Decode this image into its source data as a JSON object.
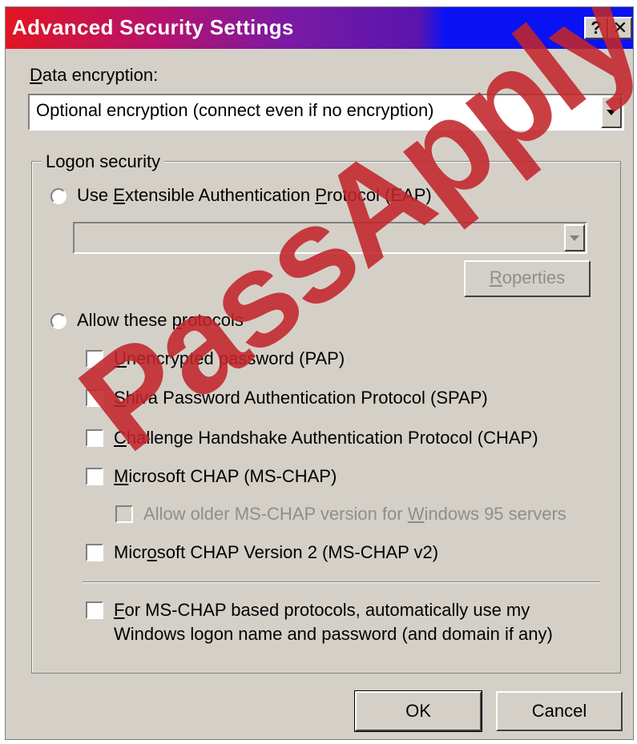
{
  "window": {
    "title": "Advanced Security Settings",
    "help_button": "?",
    "close_button": "✕"
  },
  "data_encryption": {
    "label_prefix": "",
    "label_accel": "D",
    "label_rest": "ata encryption:",
    "selected": "Optional encryption (connect even if no encryption)"
  },
  "logon_security": {
    "legend": "Logon security",
    "eap": {
      "pre": "Use ",
      "accel1": "E",
      "mid": "xtensible Authentication ",
      "accel2": "P",
      "rest": "rotocol (EAP)",
      "dropdown_value": "",
      "properties_accel": "R",
      "properties_rest": "operties"
    },
    "allow": {
      "pre": "Allow these ",
      "accel": "p",
      "rest": "rotocols"
    },
    "protocols": [
      {
        "accel": "U",
        "rest": "nencrypted password (PAP)"
      },
      {
        "accel": "S",
        "rest": "hiva Password Authentication Protocol (SPAP)"
      },
      {
        "accel": "C",
        "rest": "hallenge Handshake Authentication Protocol (CHAP)"
      },
      {
        "accel": "M",
        "rest": "icrosoft CHAP (MS-CHAP)"
      },
      {
        "pre": "Allow older MS-CHAP version for ",
        "accel": "W",
        "rest": "indows 95 servers"
      },
      {
        "pre": "Micr",
        "accel": "o",
        "rest": "soft CHAP Version 2 (MS-CHAP v2)"
      },
      {
        "accel": "F",
        "rest": "or MS-CHAP based protocols, automatically use my",
        "line2": "Windows logon name and password (and domain if any)"
      }
    ]
  },
  "buttons": {
    "ok": "OK",
    "cancel": "Cancel"
  },
  "watermark": "PassApply.com"
}
